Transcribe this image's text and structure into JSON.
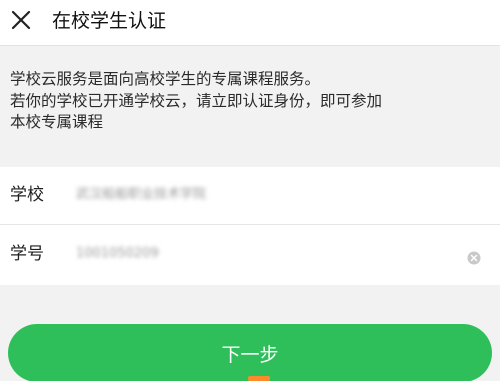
{
  "header": {
    "close_icon": "close-icon",
    "title": "在校学生认证"
  },
  "notice": {
    "lines": [
      "学校云服务是面向高校学生的专属课程服务。",
      "若你的学校已开通学校云，请立即认证身份，即可参加",
      "本校专属课程"
    ]
  },
  "form": {
    "school": {
      "label": "学校",
      "value": "武汉船舶职业技术学院"
    },
    "student_id": {
      "label": "学号",
      "value": "1001050209",
      "clear_icon": "clear-circle-icon"
    }
  },
  "actions": {
    "next_label": "下一步"
  },
  "colors": {
    "primary_green": "#2fbf5a",
    "accent_orange": "#ff8a2b",
    "background": "#f2f2f2"
  }
}
